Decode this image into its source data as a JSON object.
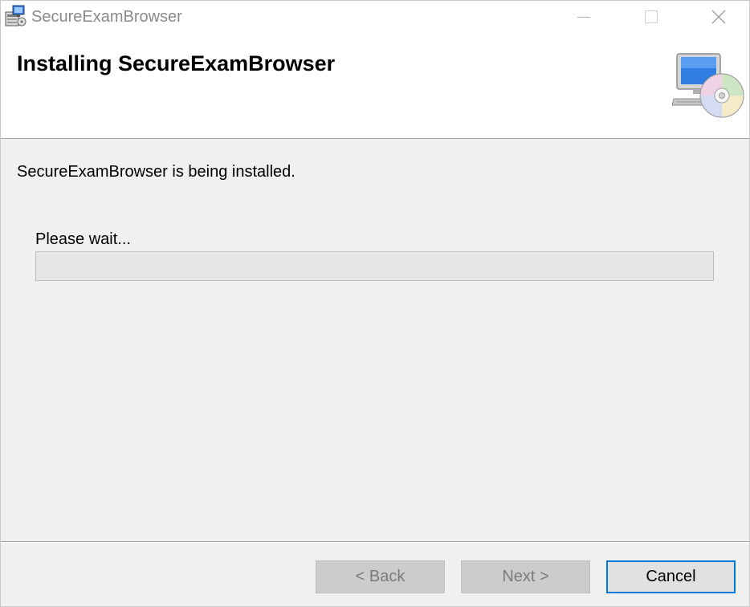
{
  "window": {
    "title": "SecureExamBrowser"
  },
  "banner": {
    "heading": "Installing SecureExamBrowser",
    "icon": "computer-disc-icon"
  },
  "body": {
    "status": "SecureExamBrowser is being installed.",
    "wait_label": "Please wait...",
    "progress_fraction": 0.0
  },
  "buttons": {
    "back": "< Back",
    "next": "Next >",
    "cancel": "Cancel"
  },
  "colors": {
    "accent": "#0078d7",
    "progress_fill": "#06b025",
    "dialog_background": "#f0f0f0"
  }
}
